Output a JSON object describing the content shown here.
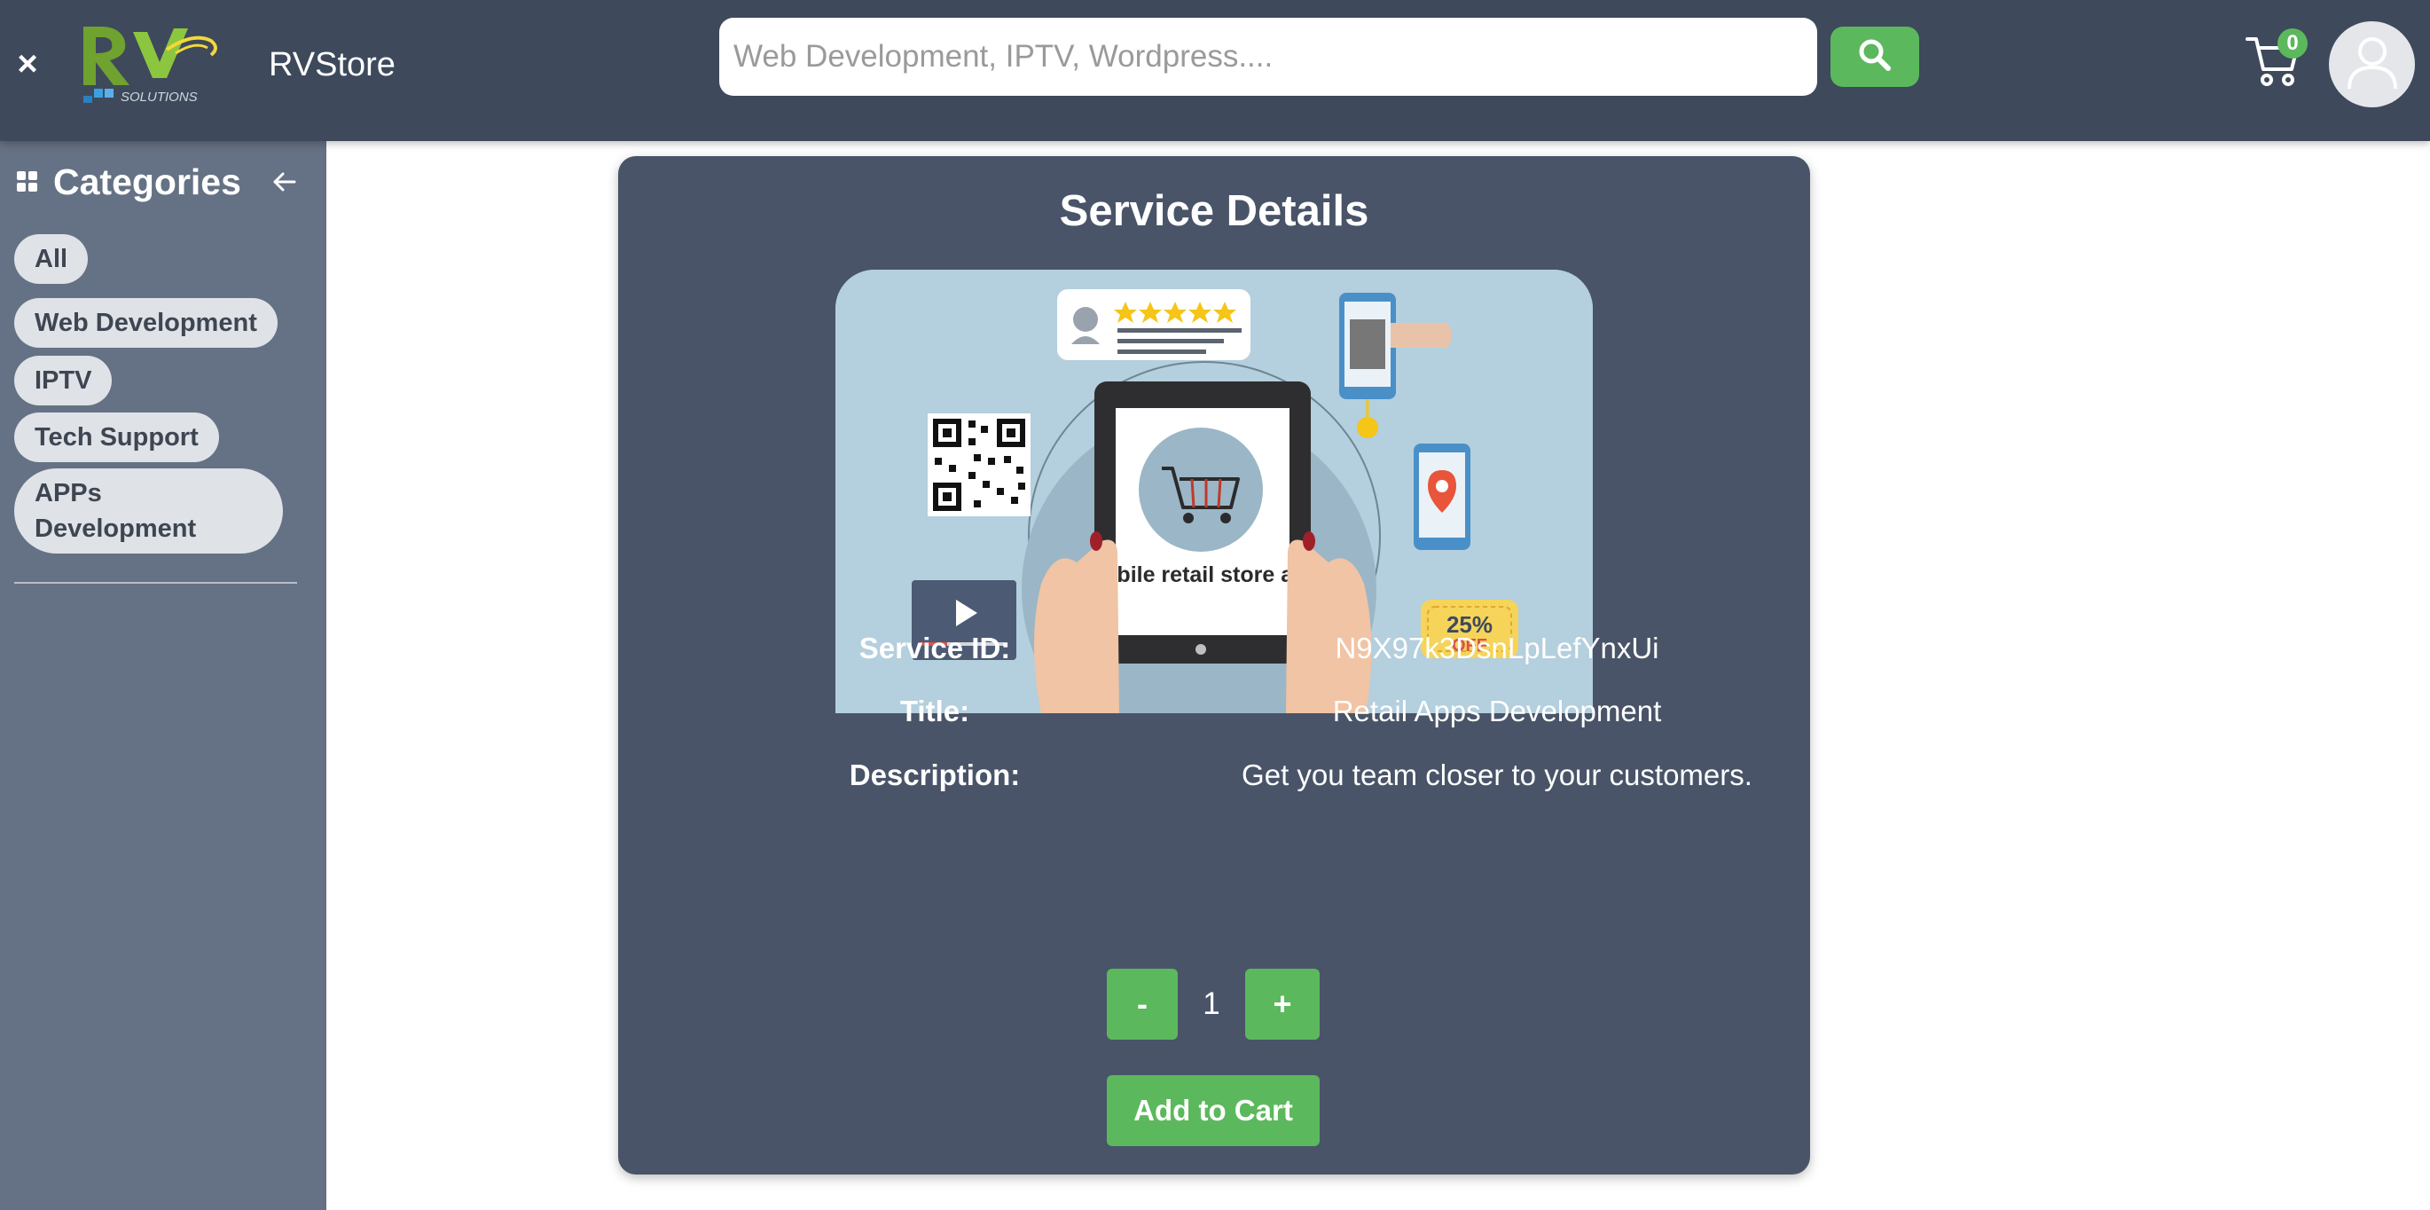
{
  "header": {
    "close_label": "×",
    "brand": "RVStore",
    "search_placeholder": "Web Development, IPTV, Wordpress....",
    "search_value": "",
    "cart_count": "0",
    "accent_color": "#5cb85c",
    "background_color": "#3e495c"
  },
  "sidebar": {
    "title": "Categories",
    "items": [
      {
        "label": "All"
      },
      {
        "label": "Web Development"
      },
      {
        "label": "IPTV"
      },
      {
        "label": "Tech Support"
      },
      {
        "label": "APPs Development"
      }
    ]
  },
  "service": {
    "title": "Service Details",
    "image": {
      "caption": "Mobile retail store app",
      "badge_percent": "25%",
      "badge_off": "OFF"
    },
    "fields": [
      {
        "label": "Service ID:",
        "value": "N9X97k3DsnLpLefYnxUi"
      },
      {
        "label": "Title:",
        "value": "Retail Apps Development"
      },
      {
        "label": "Description:",
        "value": "Get you team closer to your customers."
      }
    ],
    "quantity": {
      "minus_label": "-",
      "value": "1",
      "plus_label": "+"
    },
    "add_to_cart_label": "Add to Cart"
  }
}
